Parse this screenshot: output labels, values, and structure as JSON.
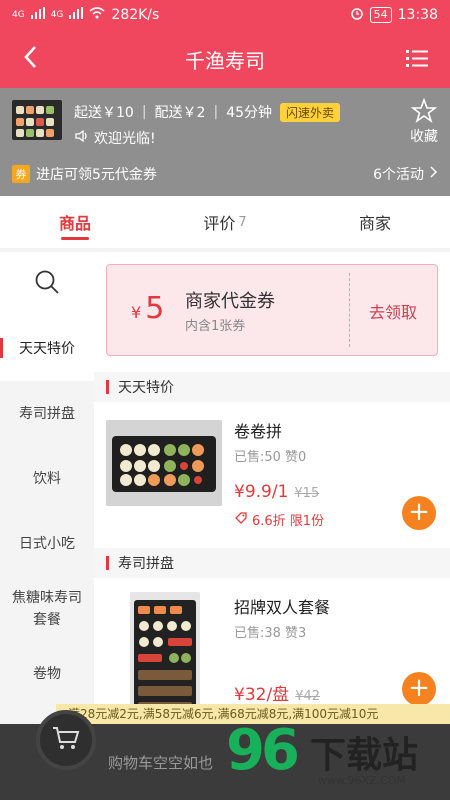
{
  "status_bar": {
    "network_1": "4G",
    "network_2": "4G",
    "speed": "282K/s",
    "battery": "54",
    "time": "13:38"
  },
  "header": {
    "title": "千渔寿司"
  },
  "store": {
    "min_order": "起送￥10",
    "delivery_fee": "配送￥2",
    "delivery_time": "45分钟",
    "tag": "闪速外卖",
    "welcome": "欢迎光临!",
    "favorite_label": "收藏",
    "coupon_chip": "券",
    "coupon_promo": "进店可领5元代金券",
    "activities": "6个活动"
  },
  "tabs": [
    {
      "label": "商品"
    },
    {
      "label": "评价",
      "count": "7"
    },
    {
      "label": "商家"
    }
  ],
  "sidebar": {
    "items": [
      {
        "label": "天天特价"
      },
      {
        "label": "寿司拼盘"
      },
      {
        "label": "饮料"
      },
      {
        "label": "日式小吃"
      },
      {
        "label": "焦糖味寿司套餐"
      },
      {
        "label": "卷物"
      }
    ]
  },
  "voucher": {
    "currency": "¥",
    "amount": "5",
    "title": "商家代金券",
    "subtitle": "内含1张券",
    "claim": "去领取"
  },
  "sections": [
    {
      "title": "天天特价",
      "product": {
        "name": "卷卷拼",
        "sales": "已售:50 赞0",
        "price": "¥9.9/1",
        "original": "¥15",
        "discount": "6.6折 限1份"
      }
    },
    {
      "title": "寿司拼盘",
      "product": {
        "name": "招牌双人套餐",
        "sales": "已售:38 赞3",
        "price": "¥32/盘",
        "original": "¥42"
      }
    }
  ],
  "cart": {
    "promo": "满28元减2元,满58元减6元,满68元减8元,满100元减10元",
    "empty_text": "购物车空空如也"
  },
  "watermark": {
    "number": "96",
    "brand": "下载站",
    "url": "www.96XZ.COM"
  },
  "colors": {
    "brand_red": "#f0475e",
    "price_red": "#e4393c",
    "add_orange": "#f5821f",
    "watermark_green": "#18b05a"
  }
}
